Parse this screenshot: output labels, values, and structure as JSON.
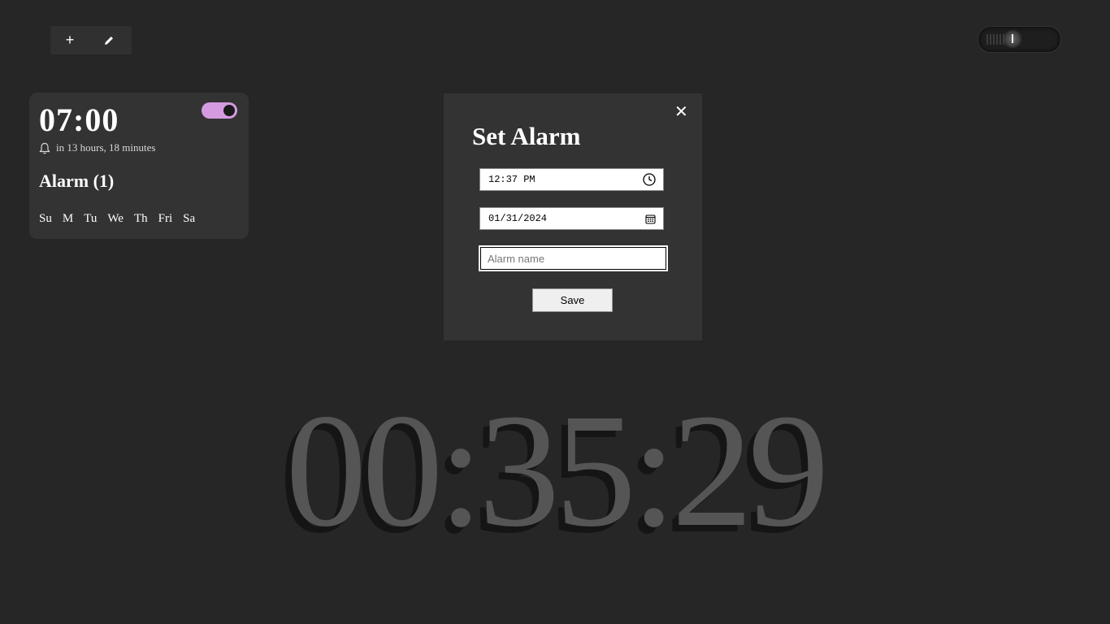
{
  "toolbar": {
    "add_label": "+",
    "edit_icon": "pencil-icon"
  },
  "theme_toggle": {
    "icon": "dial-icon"
  },
  "alarm_card": {
    "time": "07:00",
    "enabled": true,
    "until": "in 13 hours, 18 minutes",
    "name": "Alarm (1)",
    "days": [
      "Su",
      "M",
      "Tu",
      "We",
      "Th",
      "Fri",
      "Sa"
    ],
    "switch_color": "#d59be1"
  },
  "modal": {
    "title": "Set Alarm",
    "close_label": "✕",
    "time_value": "12:37 PM",
    "date_value": "01/31/2024",
    "name_placeholder": "Alarm name",
    "save_label": "Save"
  },
  "clock": {
    "time": "00:35:29"
  }
}
